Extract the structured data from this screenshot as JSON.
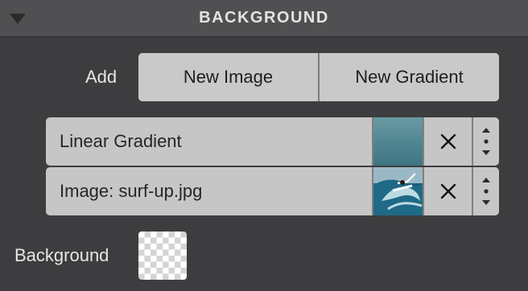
{
  "panel": {
    "title": "BACKGROUND",
    "collapse_icon": "triangle-down-icon"
  },
  "add": {
    "label": "Add",
    "new_image_label": "New Image",
    "new_gradient_label": "New Gradient"
  },
  "layers": [
    {
      "name": "Linear Gradient",
      "thumbnail": "gradient-swatch",
      "delete_icon": "close-icon",
      "reorder_icon": "reorder-handle-icon"
    },
    {
      "name": "Image: surf-up.jpg",
      "thumbnail": "surf-image-thumbnail",
      "delete_icon": "close-icon",
      "reorder_icon": "reorder-handle-icon"
    }
  ],
  "background": {
    "label": "Background",
    "swatch": "transparent-checkerboard"
  },
  "colors": {
    "panel_bg": "#3d3d3f",
    "header_bg": "#505052",
    "button_bg": "#c9c9c9",
    "row_bg": "#c6c6c6",
    "text_light": "#e6e6e6",
    "text_dark": "#262626"
  }
}
